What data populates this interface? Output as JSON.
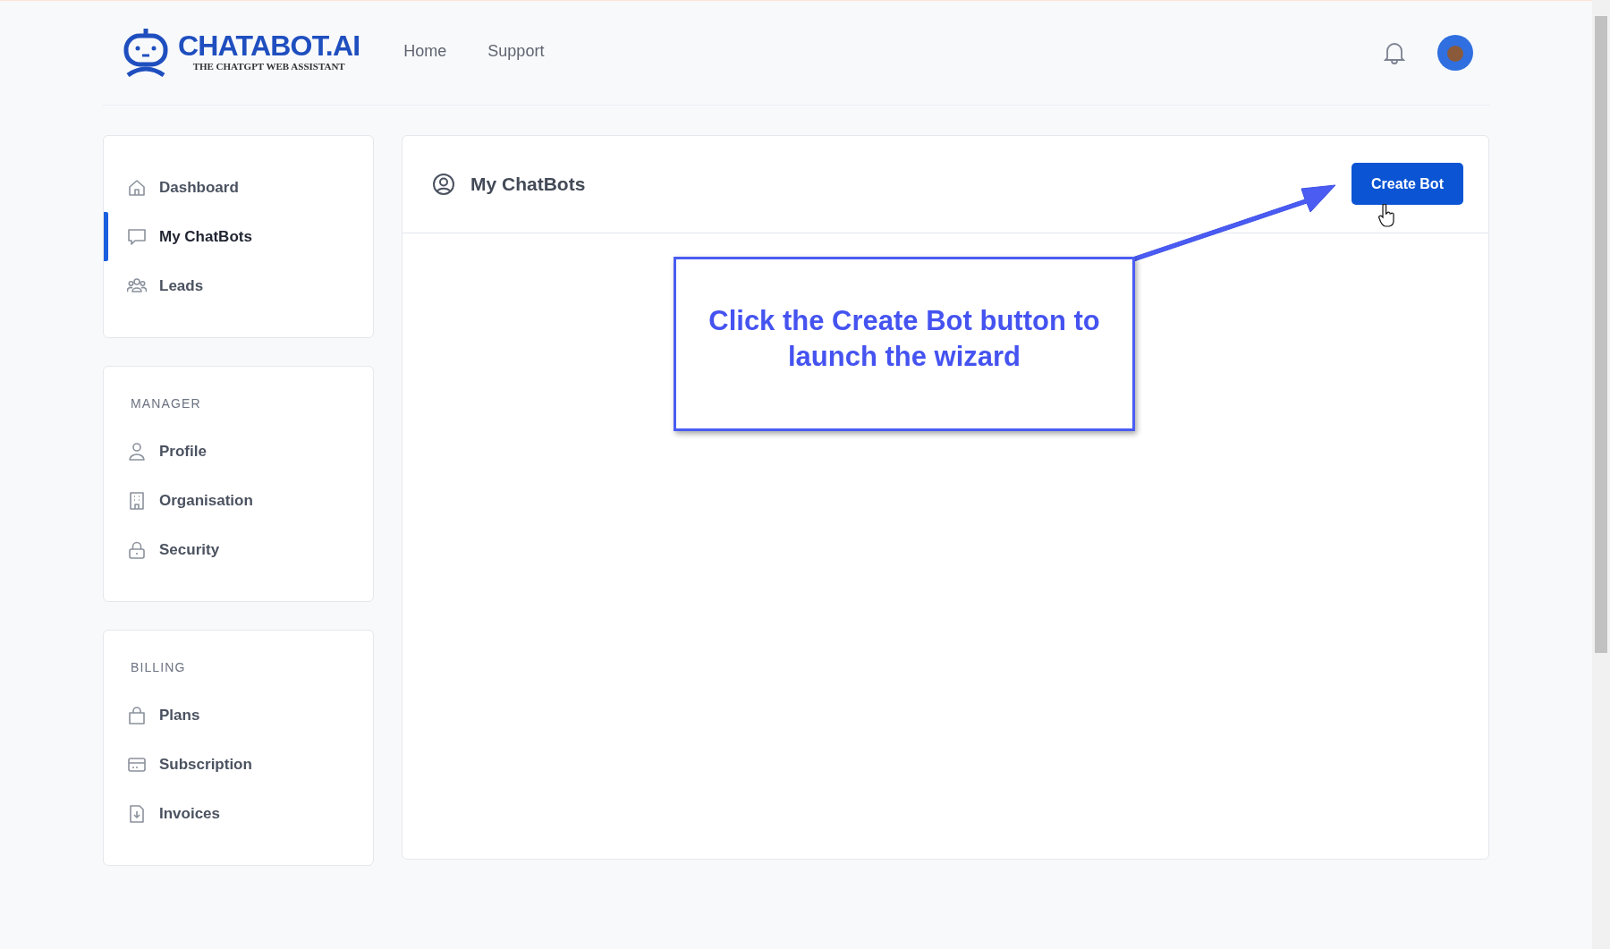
{
  "header": {
    "logo": {
      "name": "CHATABOT.AI",
      "tagline": "THE CHATGPT WEB ASSISTANT"
    },
    "nav": [
      {
        "label": "Home"
      },
      {
        "label": "Support"
      }
    ]
  },
  "sidebar": {
    "sections": [
      {
        "items": [
          {
            "label": "Dashboard",
            "selected": false
          },
          {
            "label": "My ChatBots",
            "selected": true
          },
          {
            "label": "Leads",
            "selected": false
          }
        ]
      },
      {
        "heading": "MANAGER",
        "items": [
          {
            "label": "Profile",
            "selected": false
          },
          {
            "label": "Organisation",
            "selected": false
          },
          {
            "label": "Security",
            "selected": false
          }
        ]
      },
      {
        "heading": "BILLING",
        "items": [
          {
            "label": "Plans",
            "selected": false
          },
          {
            "label": "Subscription",
            "selected": false
          },
          {
            "label": "Invoices",
            "selected": false
          }
        ]
      }
    ]
  },
  "main": {
    "title": "My ChatBots",
    "button": "Create Bot"
  },
  "callout": {
    "text": "Click the Create Bot button to launch the wizard"
  }
}
